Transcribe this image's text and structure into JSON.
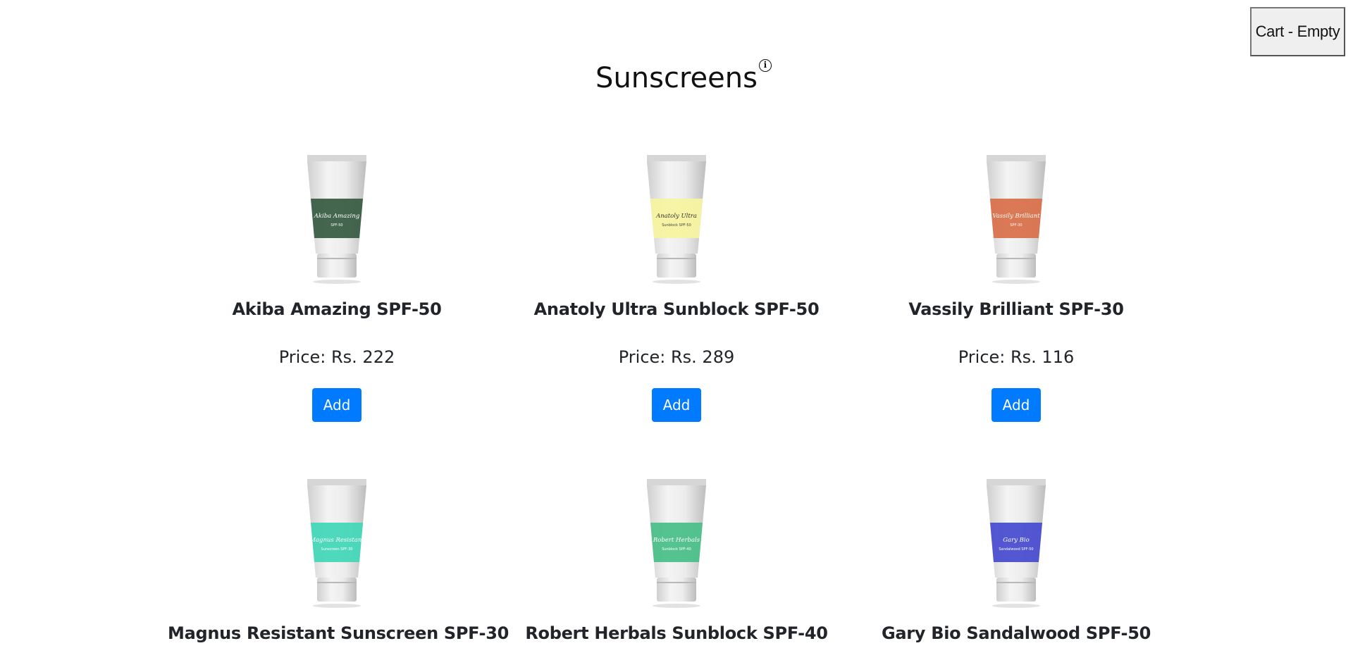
{
  "cart": {
    "label": "Cart - Empty"
  },
  "header": {
    "title": "Sunscreens",
    "info_icon": "info-icon"
  },
  "accent_color": "#007bff",
  "products": [
    {
      "name": "Akiba Amazing SPF-50",
      "price": "Price: Rs. 222",
      "add_label": "Add",
      "label_color": "#3b5e44",
      "tube_text": "Akiba Amazing",
      "tube_sub": "SPF-50"
    },
    {
      "name": "Anatoly Ultra Sunblock SPF-50",
      "price": "Price: Rs. 289",
      "add_label": "Add",
      "label_color": "#f7f3a0",
      "tube_text": "Anatoly Ultra",
      "tube_sub": "Sunblock SPF-50"
    },
    {
      "name": "Vassily Brilliant SPF-30",
      "price": "Price: Rs. 116",
      "add_label": "Add",
      "label_color": "#d9714c",
      "tube_text": "Vassily Brilliant",
      "tube_sub": "SPF-30"
    },
    {
      "name": "Magnus Resistant Sunscreen SPF-30",
      "price": "",
      "add_label": "",
      "label_color": "#46d7b8",
      "tube_text": "Magnus Resistant",
      "tube_sub": "Sunscreen SPF-30"
    },
    {
      "name": "Robert Herbals Sunblock SPF-40",
      "price": "",
      "add_label": "",
      "label_color": "#4cc08a",
      "tube_text": "Robert Herbals",
      "tube_sub": "Sunblock SPF-40"
    },
    {
      "name": "Gary Bio Sandalwood SPF-50",
      "price": "",
      "add_label": "",
      "label_color": "#4a4fd0",
      "tube_text": "Gary Bio",
      "tube_sub": "Sandalwood SPF-50"
    }
  ]
}
